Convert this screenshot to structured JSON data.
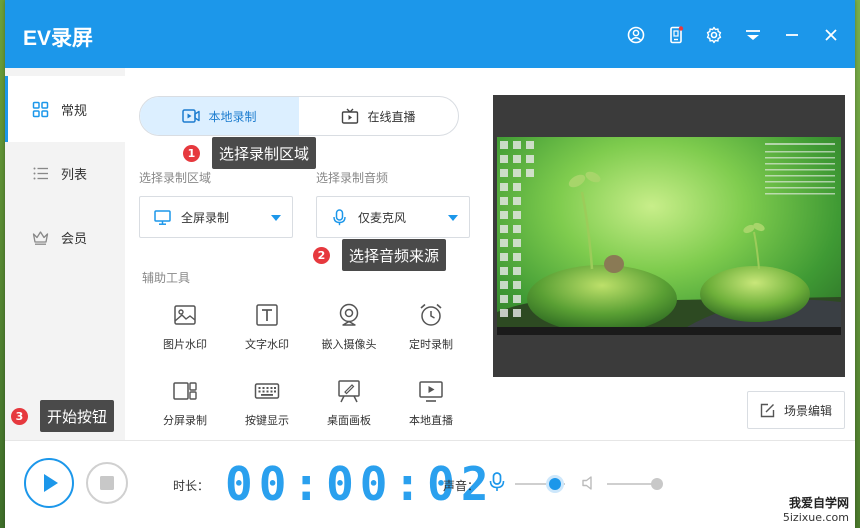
{
  "window": {
    "title": "EV录屏"
  },
  "titlebar": {
    "icons": [
      "user-circle-icon",
      "phone-notification-icon",
      "gear-icon",
      "dropdown-menu-icon",
      "minimize-icon",
      "close-icon"
    ],
    "accent": "#1c97ea"
  },
  "sidebar": {
    "items": [
      {
        "label": "常规",
        "icon": "grid-icon",
        "active": true
      },
      {
        "label": "列表",
        "icon": "list-icon",
        "active": false
      },
      {
        "label": "会员",
        "icon": "crown-icon",
        "active": false
      }
    ]
  },
  "mode_tabs": [
    {
      "label": "本地录制",
      "icon": "video-record-icon",
      "active": true
    },
    {
      "label": "在线直播",
      "icon": "tv-icon",
      "active": false
    }
  ],
  "record_area": {
    "label": "选择录制区域",
    "value": "全屏录制",
    "icon": "monitor-icon"
  },
  "record_audio": {
    "label": "选择录制音频",
    "value": "仅麦克风",
    "icon": "microphone-icon"
  },
  "tools": {
    "label": "辅助工具",
    "items": [
      {
        "label": "图片水印",
        "icon": "image-icon"
      },
      {
        "label": "文字水印",
        "icon": "text-icon"
      },
      {
        "label": "嵌入摄像头",
        "icon": "webcam-icon"
      },
      {
        "label": "定时录制",
        "icon": "alarm-clock-icon"
      },
      {
        "label": "分屏录制",
        "icon": "split-screen-icon"
      },
      {
        "label": "按键显示",
        "icon": "keyboard-icon"
      },
      {
        "label": "桌面画板",
        "icon": "drawing-board-icon"
      },
      {
        "label": "本地直播",
        "icon": "local-live-icon"
      }
    ]
  },
  "annotations": [
    {
      "num": "1",
      "text": "选择录制区域"
    },
    {
      "num": "2",
      "text": "选择音频来源"
    },
    {
      "num": "3",
      "text": "开始按钮"
    }
  ],
  "scene_edit": {
    "label": "场景编辑",
    "icon": "edit-icon"
  },
  "bottombar": {
    "duration_label": "时长：",
    "timer": "00:00:02",
    "volume_label": "声音：",
    "mic_level": 0.8,
    "speaker_level": 1.0
  },
  "watermark": {
    "line1": "我爱自学网",
    "line2": "5izixue.com"
  }
}
